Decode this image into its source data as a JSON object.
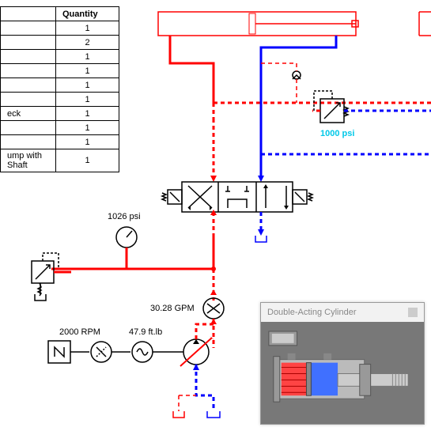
{
  "bom": {
    "header": {
      "qty": "Quantity"
    },
    "rows": [
      {
        "name": "",
        "qty": "1"
      },
      {
        "name": "",
        "qty": "2"
      },
      {
        "name": "",
        "qty": "1"
      },
      {
        "name": "",
        "qty": "1"
      },
      {
        "name": "",
        "qty": "1"
      },
      {
        "name": "",
        "qty": "1"
      },
      {
        "name": "eck",
        "qty": "1"
      },
      {
        "name": "",
        "qty": "1"
      },
      {
        "name": "",
        "qty": "1"
      },
      {
        "name": "ump with Shaft",
        "qty": "1"
      }
    ]
  },
  "labels": {
    "pressure_gauge": "1026 psi",
    "setpoint": "1000 psi",
    "flow": "30.28 GPM",
    "rpm": "2000 RPM",
    "torque": "47.9 ft.lb"
  },
  "inset": {
    "title": "Double-Acting Cylinder"
  },
  "icons": {
    "gauge": "gauge-icon",
    "relief": "relief-valve-icon",
    "motor": "motor-icon",
    "coupling": "coupling-icon",
    "pump": "variable-pump-icon",
    "flowmeter": "flow-meter-icon",
    "dcv": "directional-control-valve-icon",
    "cylinder": "cylinder-icon",
    "check": "check-valve-icon"
  }
}
